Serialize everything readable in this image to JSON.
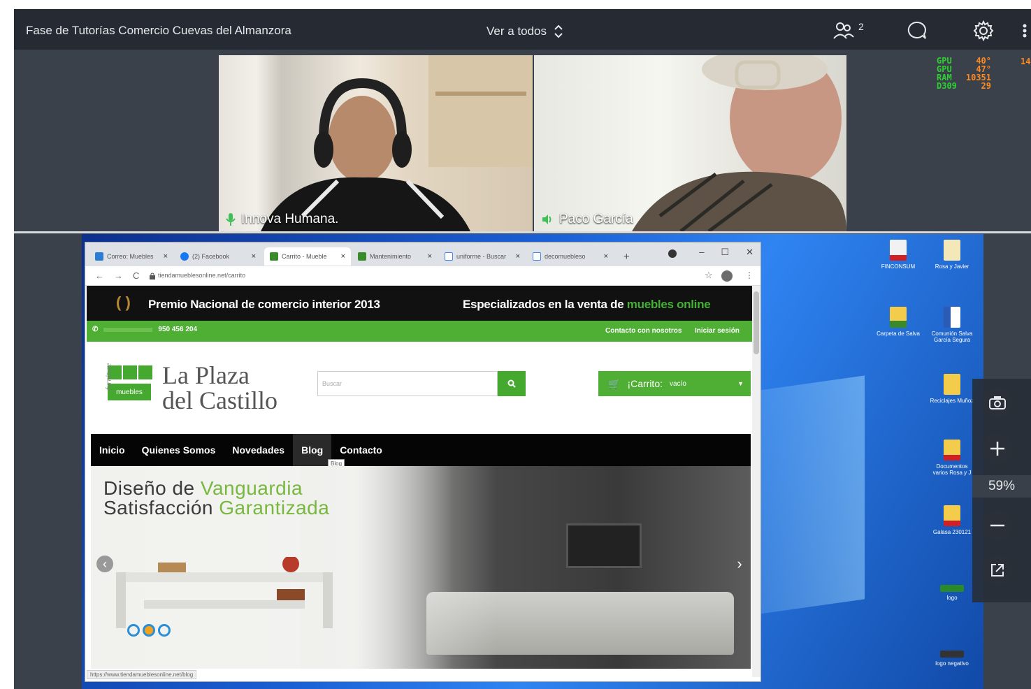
{
  "meeting": {
    "title": "Fase de Tutorías Comercio Cuevas del Almanzora",
    "view_mode": "Ver a todos",
    "participants_count": "2"
  },
  "hud": [
    {
      "k": "GPU",
      "v": "40°"
    },
    {
      "k": "GPU",
      "v": "47°"
    },
    {
      "k": "RAM",
      "v": "10351"
    },
    {
      "k": "D309",
      "v": "29"
    }
  ],
  "hud_extra": "14",
  "participants": [
    {
      "name": "Innova Humana."
    },
    {
      "name": "Paco García"
    }
  ],
  "browser": {
    "tabs": [
      "Correo: Muebles",
      "(2) Facebook",
      "Carrito - Mueble",
      "Mantenimiento",
      "uniforme - Buscar",
      "decomuebleso"
    ],
    "url": "tiendamueblesonline.net/carrito",
    "status_url": "https://www.tiendamueblesonline.net/blog"
  },
  "site": {
    "award": "Premio Nacional de comercio interior 2013",
    "spec_prefix": "Especializados en la venta de",
    "spec_accent": "muebles online",
    "phone": "950 456 204",
    "contact": "Contacto con nosotros",
    "login": "Iniciar sesión",
    "logo_line1": "La Plaza",
    "logo_line2": "del Castillo",
    "logo_sub": "muebles",
    "logo_side": "furniture",
    "search_placeholder": "Buscar",
    "cart_label": "¡Carrito:",
    "cart_state": "vacío",
    "menu": [
      "Inicio",
      "Quienes Somos",
      "Novedades",
      "Blog",
      "Contacto"
    ],
    "tooltip": "Blog",
    "hero_l1_a": "Diseño de ",
    "hero_l1_b": "Vanguardia",
    "hero_l2_a": "Satisfacción ",
    "hero_l2_b": "Garantizada"
  },
  "desktop_icons": [
    {
      "label": "FINCONSUM"
    },
    {
      "label": "Rosa y Javier"
    },
    {
      "label": "Carpeta de Salva"
    },
    {
      "label": "Comunión Salva García Segura"
    },
    {
      "label": "Reciclajes Muñoz"
    },
    {
      "label": "Documentos varios Rosa y J"
    },
    {
      "label": "Galasa 230121"
    },
    {
      "label": "logo"
    },
    {
      "label": "logo negativo"
    }
  ],
  "zoom": {
    "level": "59%"
  },
  "colors": {
    "accent_green": "#4fae34",
    "topbar": "#262b33",
    "panel": "#3b414b"
  }
}
